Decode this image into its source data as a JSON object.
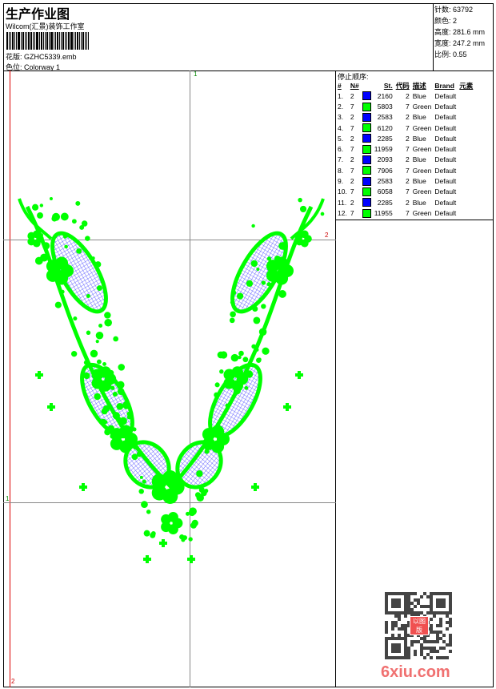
{
  "header": {
    "title": "生产作业图",
    "company": "Wilcom(汇景)装饰工作室",
    "design_label": "花版:",
    "design_value": "GZHC5339.emb",
    "colorway_label": "色位:",
    "colorway_value": "Colorway 1"
  },
  "info": {
    "stitches": "针数: 63792",
    "colors": "颜色: 2",
    "height": "高度: 281.6 mm",
    "width": "宽度: 247.2 mm",
    "scale": "比例: 0.55"
  },
  "canvas": {
    "marker_1": "1",
    "marker_2": "2"
  },
  "stop_sequence": {
    "title": "停止顺序:",
    "columns": [
      "#",
      "N#",
      "",
      "St.",
      "代码",
      "描述",
      "Brand",
      "元素"
    ],
    "rows": [
      {
        "num": "1.",
        "n": "2",
        "color": "#0000ff",
        "st": "2160",
        "code": "2",
        "desc": "Blue",
        "brand": "Default"
      },
      {
        "num": "2.",
        "n": "7",
        "color": "#00ff00",
        "st": "5803",
        "code": "7",
        "desc": "Green",
        "brand": "Default"
      },
      {
        "num": "3.",
        "n": "2",
        "color": "#0000ff",
        "st": "2583",
        "code": "2",
        "desc": "Blue",
        "brand": "Default"
      },
      {
        "num": "4.",
        "n": "7",
        "color": "#00ff00",
        "st": "6120",
        "code": "7",
        "desc": "Green",
        "brand": "Default"
      },
      {
        "num": "5.",
        "n": "2",
        "color": "#0000ff",
        "st": "2285",
        "code": "2",
        "desc": "Blue",
        "brand": "Default"
      },
      {
        "num": "6.",
        "n": "7",
        "color": "#00ff00",
        "st": "11959",
        "code": "7",
        "desc": "Green",
        "brand": "Default"
      },
      {
        "num": "7.",
        "n": "2",
        "color": "#0000ff",
        "st": "2093",
        "code": "2",
        "desc": "Blue",
        "brand": "Default"
      },
      {
        "num": "8.",
        "n": "7",
        "color": "#00ff00",
        "st": "7906",
        "code": "7",
        "desc": "Green",
        "brand": "Default"
      },
      {
        "num": "9.",
        "n": "2",
        "color": "#0000ff",
        "st": "2583",
        "code": "2",
        "desc": "Blue",
        "brand": "Default"
      },
      {
        "num": "10.",
        "n": "7",
        "color": "#00ff00",
        "st": "6058",
        "code": "7",
        "desc": "Green",
        "brand": "Default"
      },
      {
        "num": "11.",
        "n": "2",
        "color": "#0000ff",
        "st": "2285",
        "code": "2",
        "desc": "Blue",
        "brand": "Default"
      },
      {
        "num": "12.",
        "n": "7",
        "color": "#00ff00",
        "st": "11955",
        "code": "7",
        "desc": "Green",
        "brand": "Default"
      }
    ]
  },
  "watermark": {
    "text": "6xiu.com",
    "seal": "以图版"
  }
}
